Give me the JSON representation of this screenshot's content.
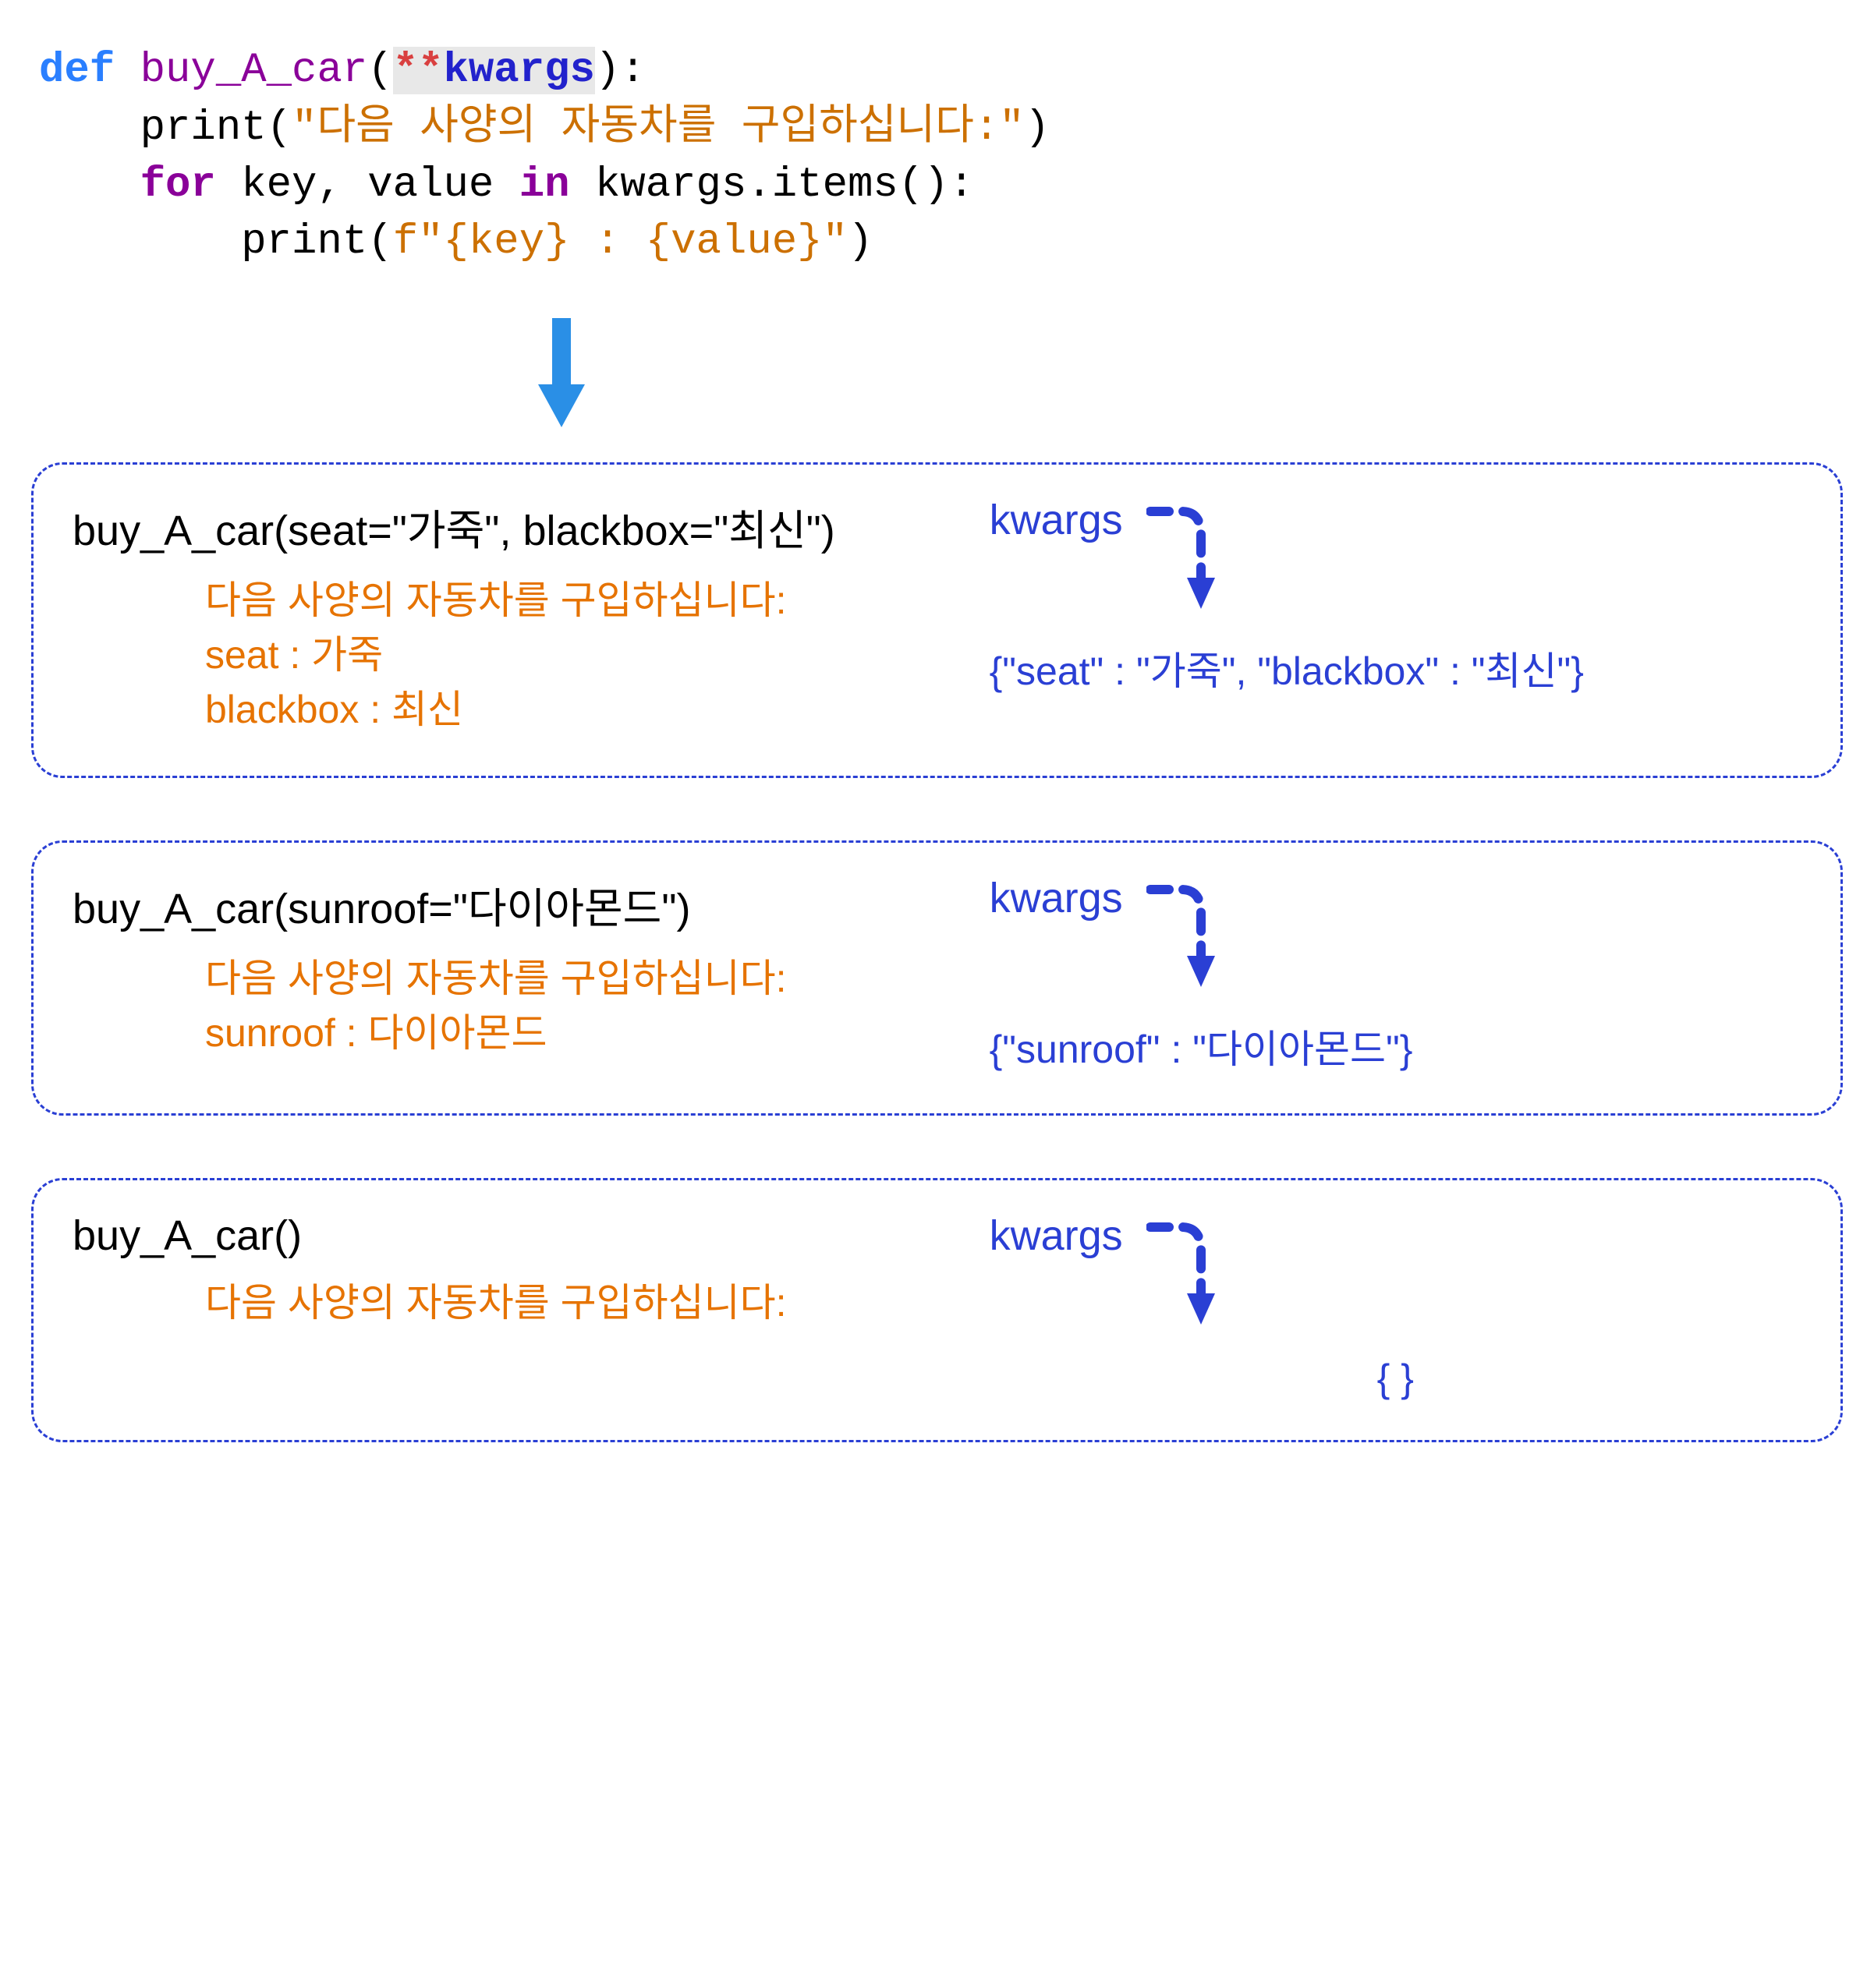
{
  "header": {
    "def": "def",
    "fname": " buy_A_car",
    "paren_open": "(",
    "stars": "**",
    "kwargs": "kwargs",
    "paren_close": "):"
  },
  "body": {
    "line1_print": "    print(",
    "line1_str": "\"다음 사양의 자동차를 구입하십니다:\"",
    "line1_close": ")",
    "line2_for": "    for ",
    "line2_vars": "key, value",
    "line2_in": " in ",
    "line2_iter": "kwargs.items():",
    "line3_print": "        print(",
    "line3_fmt": "f\"{key} : {value}\"",
    "line3_close": ")"
  },
  "examples": [
    {
      "call": "buy_A_car(seat=\"가죽\", blackbox=\"최신\")",
      "output_header": "다음 사양의 자동차를 구입하십니다:",
      "output_lines": [
        "seat : 가죽",
        "blackbox : 최신"
      ],
      "kwargs_label": "kwargs",
      "dict": "{\"seat\" : \"가죽\", \"blackbox\" : \"최신\"}",
      "dict_centered": false
    },
    {
      "call": "buy_A_car(sunroof=\"다이아몬드\")",
      "output_header": "다음 사양의 자동차를 구입하십니다:",
      "output_lines": [
        "sunroof : 다이아몬드"
      ],
      "kwargs_label": "kwargs",
      "dict": "{\"sunroof\" : \"다이아몬드\"}",
      "dict_centered": false
    },
    {
      "call": "buy_A_car()",
      "output_header": "다음 사양의 자동차를 구입하십니다:",
      "output_lines": [],
      "kwargs_label": "kwargs",
      "dict": "{ }",
      "dict_centered": true
    }
  ]
}
